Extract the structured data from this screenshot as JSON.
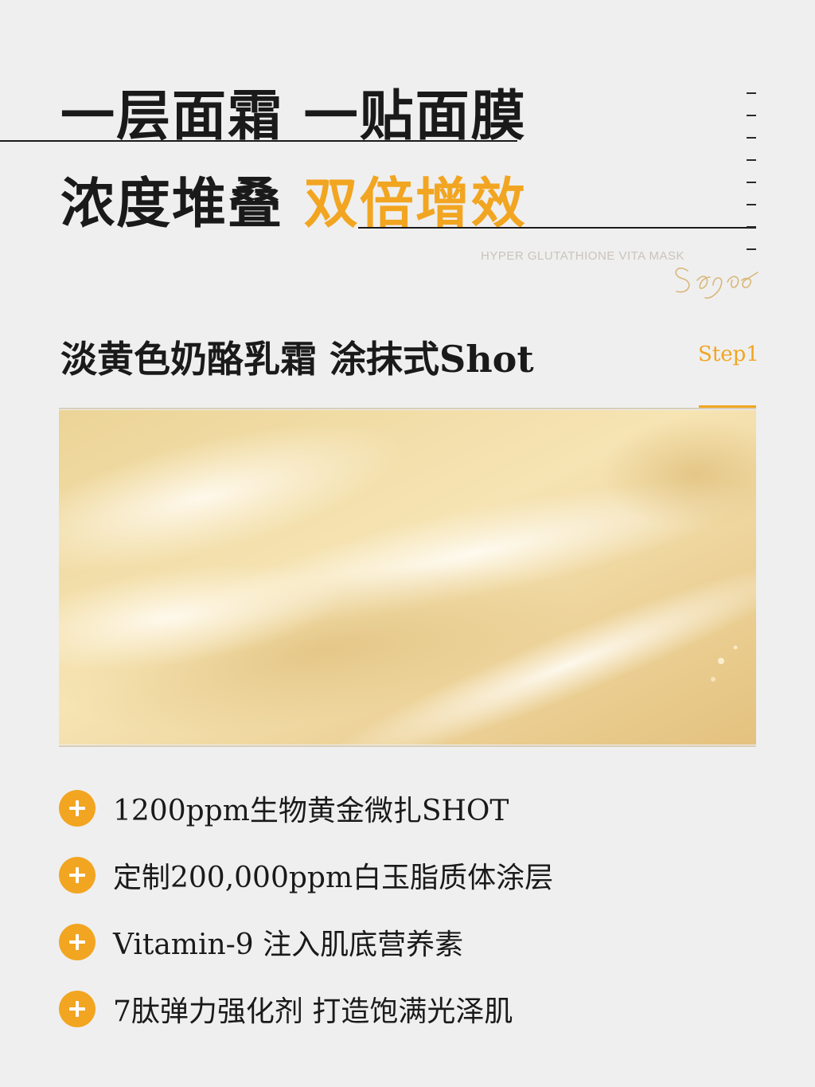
{
  "headline": {
    "line1": "一层面霜 一贴面膜",
    "line2_main": "浓度堆叠",
    "line2_accent": "双倍增效"
  },
  "watermark": "HYPER GLUTATHIONE VITA MASK",
  "signature": "Sgco",
  "subtitle": "淡黄色奶酪乳霜 涂抹式Shot",
  "step": "Step1",
  "features": [
    "1200ppm生物黄金微扎SHOT",
    "定制200,000ppm白玉脂质体涂层",
    "Vitamin-9  注入肌底营养素",
    "7肽弹力强化剂 打造饱满光泽肌"
  ],
  "colors": {
    "accent": "#f2a521",
    "background": "#efefef",
    "text": "#1a1a1a"
  }
}
